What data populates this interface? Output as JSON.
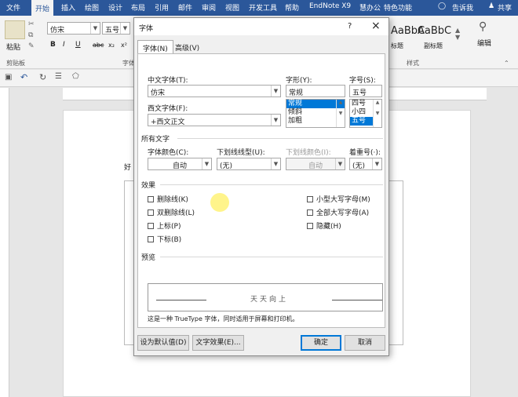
{
  "ribbon": {
    "tabs": [
      "文件",
      "开始",
      "插入",
      "绘图",
      "设计",
      "布局",
      "引用",
      "邮件",
      "审阅",
      "视图",
      "开发工具",
      "帮助",
      "EndNote X9",
      "慧办公",
      "特色功能"
    ],
    "active_tab": "开始",
    "tell_me": "告诉我",
    "share": "共享",
    "paste_label": "粘贴",
    "clipboard_group": "剪贴板",
    "font_group_partial": "字体",
    "font_name": "仿宋",
    "font_size": "五号",
    "styles_group": "样式",
    "style1_preview": "AaBbC",
    "style1_name": "标题",
    "style2_preview": "AaBbC",
    "style2_name": "副标题",
    "edit_label": "编辑",
    "doc_text_partial": "好"
  },
  "dialog": {
    "title": "字体",
    "help": "?",
    "close": "×",
    "tab_font": "字体(N)",
    "tab_advanced": "高级(V)",
    "cn_font_label": "中文字体(T):",
    "cn_font_value": "仿宋",
    "western_font_label": "西文字体(F):",
    "western_font_value": "+西文正文",
    "style_label": "字形(Y):",
    "style_value": "常规",
    "style_options": [
      "常规",
      "倾斜",
      "加粗"
    ],
    "size_label": "字号(S):",
    "size_value": "五号",
    "size_options": [
      "四号",
      "小四",
      "五号"
    ],
    "all_text_section": "所有文字",
    "font_color_label": "字体颜色(C):",
    "font_color_value": "自动",
    "underline_type_label": "下划线线型(U):",
    "underline_type_value": "(无)",
    "underline_color_label": "下划线颜色(I):",
    "underline_color_value": "自动",
    "emphasis_label": "着重号(·):",
    "emphasis_value": "(无)",
    "effects_section": "效果",
    "effects_left": [
      "删除线(K)",
      "双删除线(L)",
      "上标(P)",
      "下标(B)"
    ],
    "effects_right": [
      "小型大写字母(M)",
      "全部大写字母(A)",
      "隐藏(H)"
    ],
    "preview_section": "预览",
    "preview_text": "天天向上",
    "note": "这是一种 TrueType 字体，同时适用于屏幕和打印机。",
    "btn_default": "设为默认值(D)",
    "btn_effects": "文字效果(E)...",
    "btn_ok": "确定",
    "btn_cancel": "取消"
  },
  "colors": {
    "ribbon_blue": "#2b579a",
    "selection_blue": "#0078d7"
  }
}
